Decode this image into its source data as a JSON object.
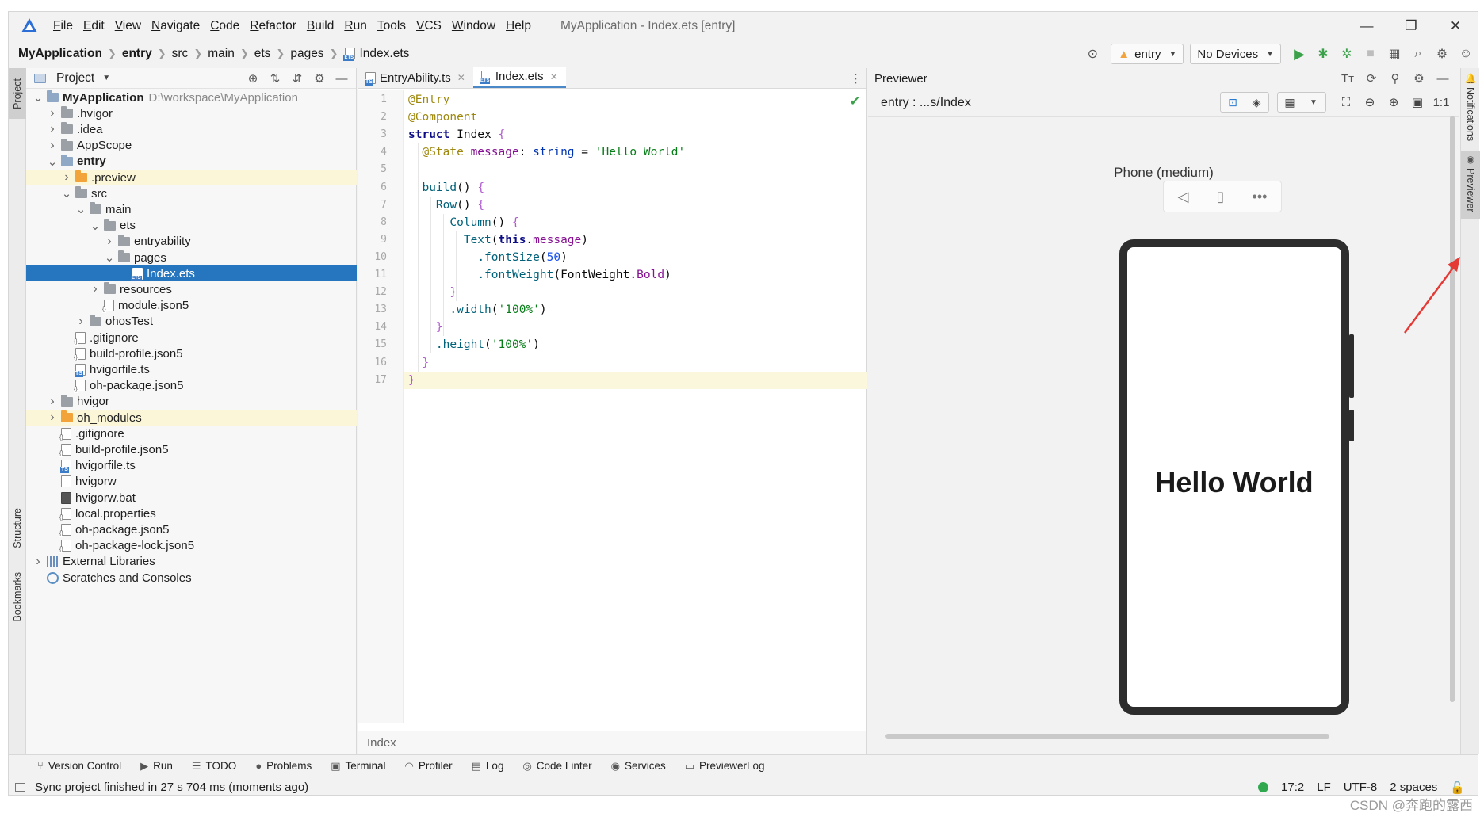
{
  "menu": {
    "items": [
      "File",
      "Edit",
      "View",
      "Navigate",
      "Code",
      "Refactor",
      "Build",
      "Run",
      "Tools",
      "VCS",
      "Window",
      "Help"
    ],
    "window_title": "MyApplication - Index.ets [entry]",
    "minimize": "—",
    "maximize": "❐",
    "close": "✕"
  },
  "breadcrumbs": [
    "MyApplication",
    "entry",
    "src",
    "main",
    "ets",
    "pages",
    "Index.ets"
  ],
  "run_config": {
    "module": "entry",
    "device": "No Devices"
  },
  "project": {
    "title": "Project",
    "root_path": "D:\\workspace\\MyApplication",
    "tree": [
      {
        "label": "MyApplication",
        "indent": 0,
        "chev": "v",
        "icon": "folder-blue",
        "bold": true
      },
      {
        "label": ".hvigor",
        "indent": 1,
        "chev": ">",
        "icon": "folder"
      },
      {
        "label": ".idea",
        "indent": 1,
        "chev": ">",
        "icon": "folder"
      },
      {
        "label": "AppScope",
        "indent": 1,
        "chev": ">",
        "icon": "folder"
      },
      {
        "label": "entry",
        "indent": 1,
        "chev": "v",
        "icon": "folder-blue",
        "bold": true
      },
      {
        "label": ".preview",
        "indent": 2,
        "chev": ">",
        "icon": "folder-orange",
        "highlight": true
      },
      {
        "label": "src",
        "indent": 2,
        "chev": "v",
        "icon": "folder"
      },
      {
        "label": "main",
        "indent": 3,
        "chev": "v",
        "icon": "folder"
      },
      {
        "label": "ets",
        "indent": 4,
        "chev": "v",
        "icon": "folder"
      },
      {
        "label": "entryability",
        "indent": 5,
        "chev": ">",
        "icon": "folder"
      },
      {
        "label": "pages",
        "indent": 5,
        "chev": "v",
        "icon": "folder"
      },
      {
        "label": "Index.ets",
        "indent": 6,
        "chev": "",
        "icon": "file-ets",
        "selected": true
      },
      {
        "label": "resources",
        "indent": 4,
        "chev": ">",
        "icon": "folder"
      },
      {
        "label": "module.json5",
        "indent": 4,
        "chev": "",
        "icon": "file-cfg"
      },
      {
        "label": "ohosTest",
        "indent": 3,
        "chev": ">",
        "icon": "folder"
      },
      {
        "label": ".gitignore",
        "indent": 2,
        "chev": "",
        "icon": "file-cfg"
      },
      {
        "label": "build-profile.json5",
        "indent": 2,
        "chev": "",
        "icon": "file-cfg"
      },
      {
        "label": "hvigorfile.ts",
        "indent": 2,
        "chev": "",
        "icon": "file-ts"
      },
      {
        "label": "oh-package.json5",
        "indent": 2,
        "chev": "",
        "icon": "file-cfg"
      },
      {
        "label": "hvigor",
        "indent": 1,
        "chev": ">",
        "icon": "folder"
      },
      {
        "label": "oh_modules",
        "indent": 1,
        "chev": ">",
        "icon": "folder-orange",
        "highlight": true
      },
      {
        "label": ".gitignore",
        "indent": 1,
        "chev": "",
        "icon": "file-cfg"
      },
      {
        "label": "build-profile.json5",
        "indent": 1,
        "chev": "",
        "icon": "file-cfg"
      },
      {
        "label": "hvigorfile.ts",
        "indent": 1,
        "chev": "",
        "icon": "file-ts"
      },
      {
        "label": "hvigorw",
        "indent": 1,
        "chev": "",
        "icon": "file"
      },
      {
        "label": "hvigorw.bat",
        "indent": 1,
        "chev": "",
        "icon": "file-dark"
      },
      {
        "label": "local.properties",
        "indent": 1,
        "chev": "",
        "icon": "file-cfg"
      },
      {
        "label": "oh-package.json5",
        "indent": 1,
        "chev": "",
        "icon": "file-cfg"
      },
      {
        "label": "oh-package-lock.json5",
        "indent": 1,
        "chev": "",
        "icon": "file-cfg"
      },
      {
        "label": "External Libraries",
        "indent": 0,
        "chev": ">",
        "icon": "libs"
      },
      {
        "label": "Scratches and Consoles",
        "indent": 0,
        "chev": "",
        "icon": "scratch"
      }
    ]
  },
  "left_strip": {
    "project": "Project",
    "structure": "Structure",
    "bookmarks": "Bookmarks"
  },
  "editor": {
    "tabs": [
      {
        "label": "EntryAbility.ts",
        "active": false
      },
      {
        "label": "Index.ets",
        "active": true
      }
    ],
    "line_numbers": [
      "1",
      "2",
      "3",
      "4",
      "5",
      "6",
      "7",
      "8",
      "9",
      "10",
      "11",
      "12",
      "13",
      "14",
      "15",
      "16",
      "17"
    ],
    "code": [
      [
        [
          "@Entry",
          "ann"
        ]
      ],
      [
        [
          "@Component",
          "ann"
        ]
      ],
      [
        [
          "struct ",
          "kwb"
        ],
        [
          "Index ",
          "plain"
        ],
        [
          "{",
          "brace"
        ]
      ],
      [
        [
          "  ",
          "plain"
        ],
        [
          "@State ",
          "ann"
        ],
        [
          "message",
          "prop"
        ],
        [
          ": ",
          "plain"
        ],
        [
          "string",
          "kw"
        ],
        [
          " = ",
          "plain"
        ],
        [
          "'Hello World'",
          "str"
        ]
      ],
      [],
      [
        [
          "  ",
          "plain"
        ],
        [
          "build",
          "fn"
        ],
        [
          "() ",
          "plain"
        ],
        [
          "{",
          "brace"
        ]
      ],
      [
        [
          "    ",
          "plain"
        ],
        [
          "Row",
          "fn"
        ],
        [
          "() ",
          "plain"
        ],
        [
          "{",
          "brace"
        ]
      ],
      [
        [
          "      ",
          "plain"
        ],
        [
          "Column",
          "fn"
        ],
        [
          "() ",
          "plain"
        ],
        [
          "{",
          "brace"
        ]
      ],
      [
        [
          "        ",
          "plain"
        ],
        [
          "Text",
          "fn"
        ],
        [
          "(",
          "plain"
        ],
        [
          "this",
          "kwb"
        ],
        [
          ".",
          "plain"
        ],
        [
          "message",
          "prop"
        ],
        [
          ")",
          "plain"
        ]
      ],
      [
        [
          "          ",
          "plain"
        ],
        [
          ".fontSize",
          "fn"
        ],
        [
          "(",
          "plain"
        ],
        [
          "50",
          "num"
        ],
        [
          ")",
          "plain"
        ]
      ],
      [
        [
          "          ",
          "plain"
        ],
        [
          ".fontWeight",
          "fn"
        ],
        [
          "(",
          "plain"
        ],
        [
          "FontWeight",
          "plain"
        ],
        [
          ".",
          "plain"
        ],
        [
          "Bold",
          "prop"
        ],
        [
          ")",
          "plain"
        ]
      ],
      [
        [
          "      ",
          "plain"
        ],
        [
          "}",
          "brace"
        ]
      ],
      [
        [
          "      ",
          "plain"
        ],
        [
          ".width",
          "fn"
        ],
        [
          "(",
          "plain"
        ],
        [
          "'100%'",
          "str"
        ],
        [
          ")",
          "plain"
        ]
      ],
      [
        [
          "    ",
          "plain"
        ],
        [
          "}",
          "brace"
        ]
      ],
      [
        [
          "    ",
          "plain"
        ],
        [
          ".height",
          "fn"
        ],
        [
          "(",
          "plain"
        ],
        [
          "'100%'",
          "str"
        ],
        [
          ")",
          "plain"
        ]
      ],
      [
        [
          "  ",
          "plain"
        ],
        [
          "}",
          "brace"
        ]
      ],
      [
        [
          "}",
          "brace"
        ]
      ]
    ],
    "footer": "Index"
  },
  "previewer": {
    "title": "Previewer",
    "route": "entry : ...s/Index",
    "device_name": "Phone (medium)",
    "rendered_text": "Hello World",
    "zoom_label": "1:1"
  },
  "right_strip": {
    "notifications": "Notifications",
    "previewer": "Previewer"
  },
  "tool_windows": [
    "Version Control",
    "Run",
    "TODO",
    "Problems",
    "Terminal",
    "Profiler",
    "Log",
    "Code Linter",
    "Services",
    "PreviewerLog"
  ],
  "status": {
    "message": "Sync project finished in 27 s 704 ms (moments ago)",
    "position": "17:2",
    "line_sep": "LF",
    "encoding": "UTF-8",
    "indent": "2 spaces"
  },
  "watermark": "CSDN @奔跑的露西"
}
